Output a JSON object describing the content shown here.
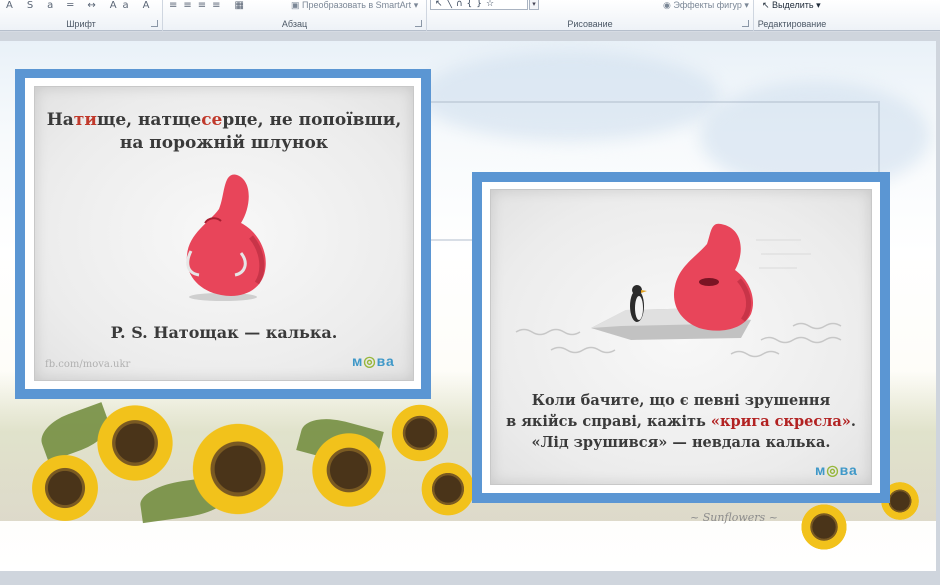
{
  "ribbon": {
    "groups": {
      "font": "Шрифт",
      "paragraph": "Абзац",
      "drawing": "Рисование",
      "editing": "Редактирование"
    },
    "buttons": {
      "smartart": "Преобразовать в SmartArt",
      "shape_effects": "Эффекты фигур",
      "select": "Выделить"
    }
  },
  "slide": {
    "card1": {
      "title_part1": "На",
      "title_stress1": "ти",
      "title_part2": "ще, натще",
      "title_stress2": "се",
      "title_part3": "рце, не попоївши,",
      "title_line2": "на порожній шлунок",
      "note": "P. S. Натощак — калька.",
      "source": "fb.com/mova.ukr",
      "logo": "мова"
    },
    "card2": {
      "line1": "Коли бачите, що є певні зрушення",
      "line2_prefix": "в якійсь справі, кажіть ",
      "line2_highlight": "«крига скресла»",
      "line2_suffix": ".",
      "line3": "«Лід зрушився» — невдала калька.",
      "logo": "мова"
    }
  },
  "colors": {
    "card_border": "#5b96d3",
    "accent_red": "#b22222",
    "character": "#e8455a"
  }
}
